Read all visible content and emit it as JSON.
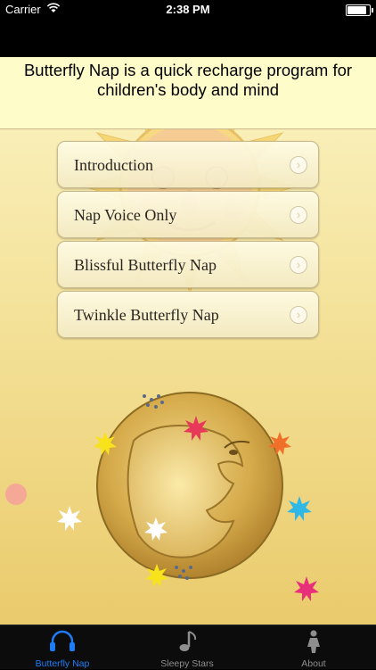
{
  "status_bar": {
    "carrier": "Carrier",
    "time": "2:38 PM",
    "battery_level": 0.95
  },
  "header": {
    "text": "Butterfly Nap is a quick recharge program for children's body and mind"
  },
  "menu": {
    "items": [
      {
        "label": "Introduction"
      },
      {
        "label": "Nap Voice Only"
      },
      {
        "label": "Blissful Butterfly Nap"
      },
      {
        "label": "Twinkle Butterfly Nap"
      }
    ],
    "chevron": "›"
  },
  "tabs": [
    {
      "label": "Butterfly Nap",
      "icon": "headphones-icon",
      "active": true
    },
    {
      "label": "Sleepy Stars",
      "icon": "music-note-icon",
      "active": false
    },
    {
      "label": "About",
      "icon": "person-icon",
      "active": false
    }
  ],
  "colors": {
    "accent": "#1e7cf5",
    "tab_inactive": "#8e8e8e",
    "background_top": "#fbf3c2",
    "background_bottom": "#eacb6c"
  }
}
